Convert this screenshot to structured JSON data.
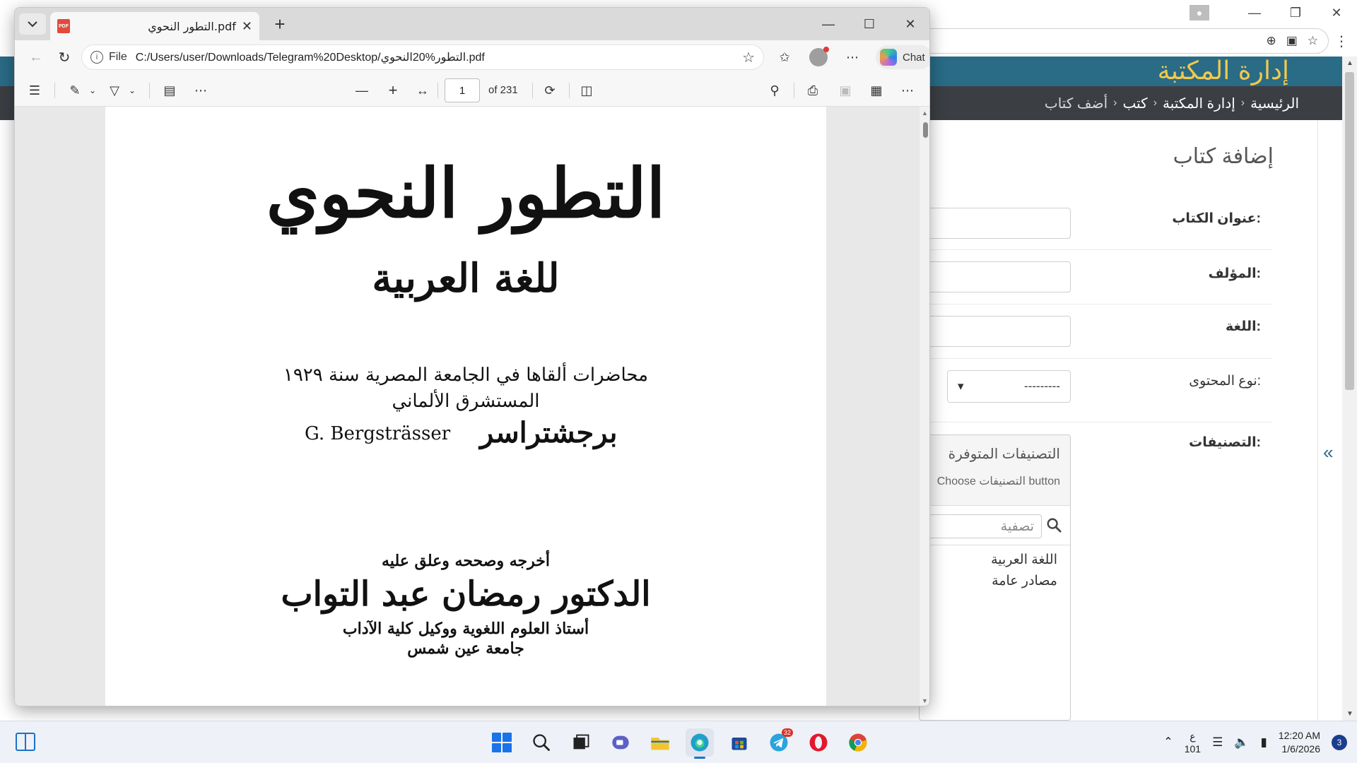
{
  "bg_browser": {
    "address_icons": [
      "zoom-icon",
      "translate-icon",
      "star-icon"
    ],
    "menu_icon": "more-vert-icon"
  },
  "admin": {
    "brand": "إدارة المكتبة",
    "breadcrumbs": [
      "الرئيسية",
      "إدارة المكتبة",
      "كتب",
      "أضف كتاب"
    ],
    "page_title": "إضافة كتاب",
    "fields": {
      "title_label": "عنوان الكتاب:",
      "author_label": "المؤلف:",
      "language_label": "اللغة:",
      "content_type_label": "نوع المحتوى:",
      "content_type_value": "---------",
      "categories_label": "التصنيفات:"
    },
    "selector": {
      "title": "التصنيفات المتوفرة",
      "help": "Choose التصنيفات button",
      "filter_placeholder": "تصفية",
      "options": [
        "اللغة العربية",
        "مصادر عامة"
      ]
    },
    "collapse_symbol": "«"
  },
  "edge": {
    "tab_title": "التطور النحوي.pdf",
    "tab_icon_text": "PDF",
    "address_scheme": "File",
    "address_url": "C:/Users/user/Downloads/Telegram%20Desktop/التطور%20النحوي.pdf",
    "chat_label": "Chat",
    "page_current": "1",
    "page_total": "of 231"
  },
  "pdf_content": {
    "title": "التطور النحوي",
    "subtitle": "للغة العربية",
    "lectures": "محاضرات ألقاها في الجامعة المصرية سنة ١٩٢٩",
    "orientalist": "المستشرق الألماني",
    "author_latin": "G. Bergsträsser",
    "author_arabic": "برجشتراسر",
    "edited_by": "أخرجه وصححه وعلق عليه",
    "editor": "الدكتور رمضان عبد التواب",
    "editor_title": "أستاذ العلوم اللغوية ووكيل كلية الآداب",
    "editor_university": "جامعة عين شمس"
  },
  "taskbar": {
    "apps": [
      "start",
      "search",
      "task-view",
      "meet",
      "file-explorer",
      "edge",
      "store",
      "telegram",
      "opera",
      "chrome"
    ],
    "telegram_badge": "32",
    "input_lang": "ع",
    "input_lang_num": "101",
    "time": "12:20 AM",
    "date": "1/6/2026",
    "notifications": "3"
  }
}
